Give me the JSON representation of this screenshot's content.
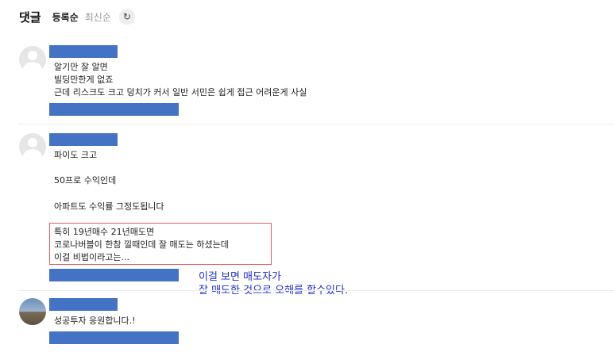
{
  "header": {
    "title": "댓글",
    "sort_registered": "등록순",
    "sort_latest": "최신순",
    "refresh_icon": "refresh-icon"
  },
  "comments": [
    {
      "avatar": "default-avatar",
      "lines": [
        "알기만 잘 알면",
        "빌딩만한게 없죠",
        "근데 리스크도 크고 덩치가 커서 일반 서민은 쉽게 접근 어려운게 사실"
      ]
    },
    {
      "avatar": "default-avatar",
      "lines": [
        "파이도 크고",
        "50프로 수익인데",
        "아파트도 수익률 그정도됩니다",
        "특히 19년매수 21년매도면",
        "코로나버블이 한참 낄때인데 잘 매도는 하셨는데",
        "이걸 비법이라고는..."
      ]
    },
    {
      "avatar": "photo-avatar",
      "lines": [
        "성공투자 응원합니다.!"
      ]
    }
  ],
  "annotation": {
    "line1": "이걸 보면 매도자가",
    "line2": "잘 매도한 것으로 오해를 할수있다."
  },
  "colors": {
    "redaction": "#4472c4",
    "highlight_border": "#e06060",
    "annotation_text": "#1f2fc4"
  }
}
